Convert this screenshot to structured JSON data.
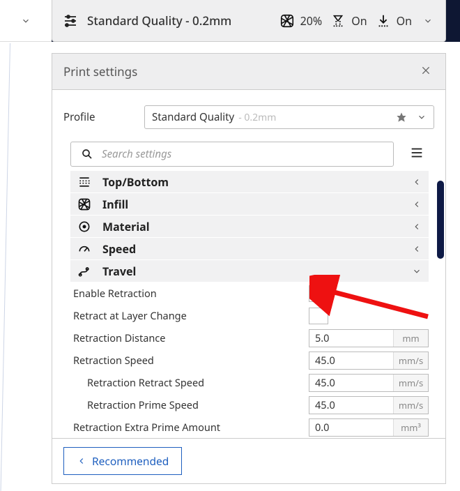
{
  "topbar": {
    "profile_title": "Standard Quality - 0.2mm",
    "infill_pct": "20%",
    "support": "On",
    "adhesion": "On"
  },
  "panel": {
    "title": "Print settings",
    "profile_label": "Profile",
    "profile_name": "Standard Quality",
    "profile_sub": "- 0.2mm",
    "search_placeholder": "Search settings",
    "categories": {
      "topbottom": "Top/Bottom",
      "infill": "Infill",
      "material": "Material",
      "speed": "Speed",
      "travel": "Travel"
    },
    "settings": {
      "enable_retraction": {
        "label": "Enable Retraction",
        "checked": true
      },
      "retract_layer_change": {
        "label": "Retract at Layer Change",
        "checked": false
      },
      "retraction_distance": {
        "label": "Retraction Distance",
        "value": "5.0",
        "unit": "mm"
      },
      "retraction_speed": {
        "label": "Retraction Speed",
        "value": "45.0",
        "unit": "mm/s"
      },
      "retraction_retract_speed": {
        "label": "Retraction Retract Speed",
        "value": "45.0",
        "unit": "mm/s"
      },
      "retraction_prime_speed": {
        "label": "Retraction Prime Speed",
        "value": "45.0",
        "unit": "mm/s"
      },
      "retraction_extra_prime": {
        "label": "Retraction Extra Prime Amount",
        "value": "0.0",
        "unit": "mm³"
      }
    },
    "footer_button": "Recommended"
  }
}
